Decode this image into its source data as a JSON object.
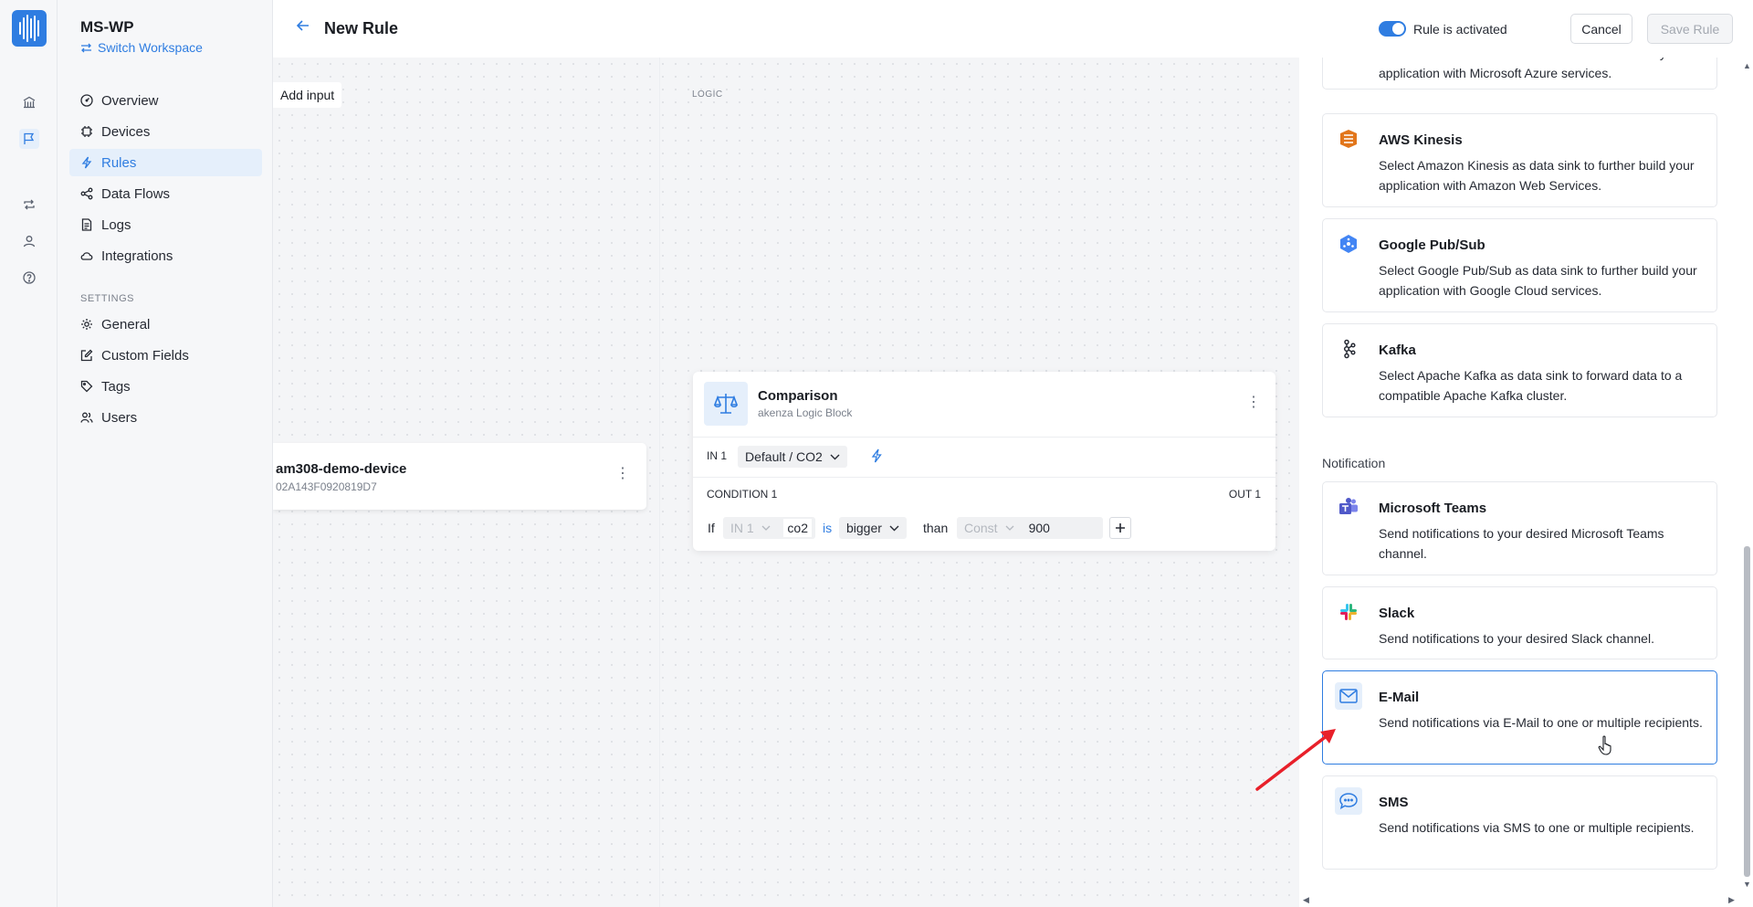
{
  "workspace": {
    "name": "MS-WP",
    "switch_label": "Switch Workspace"
  },
  "nav": {
    "items": [
      {
        "label": "Overview",
        "icon": "gauge-icon"
      },
      {
        "label": "Devices",
        "icon": "chip-icon"
      },
      {
        "label": "Rules",
        "icon": "lightning-icon",
        "active": true
      },
      {
        "label": "Data Flows",
        "icon": "share-icon"
      },
      {
        "label": "Logs",
        "icon": "document-icon"
      },
      {
        "label": "Integrations",
        "icon": "cloud-icon"
      }
    ],
    "settings_header": "SETTINGS",
    "settings_items": [
      {
        "label": "General",
        "icon": "gear-icon"
      },
      {
        "label": "Custom Fields",
        "icon": "edit-icon"
      },
      {
        "label": "Tags",
        "icon": "tag-icon"
      },
      {
        "label": "Users",
        "icon": "users-icon"
      }
    ]
  },
  "header": {
    "title": "New Rule",
    "toggle_label": "Rule is activated",
    "cancel_label": "Cancel",
    "save_label": "Save Rule"
  },
  "canvas": {
    "add_input_label": "Add input",
    "logic_label": "LOGIC",
    "device": {
      "name": "am308-demo-device",
      "id": "02A143F0920819D7"
    },
    "comparison": {
      "title": "Comparison",
      "subtitle": "akenza Logic Block",
      "in_label": "IN 1",
      "in_select": "Default / CO2",
      "condition_label": "CONDITION 1",
      "out_label": "OUT 1",
      "if_label": "If",
      "operand_in": "IN 1",
      "operand_field": "co2",
      "is_label": "is",
      "operator": "bigger",
      "than_label": "than",
      "const_label": "Const",
      "const_value": "900"
    }
  },
  "panel": {
    "partial_desc": "Select Azure IoT Hub as data sink to further build your application with Microsoft Azure services.",
    "data_sinks": [
      {
        "title": "AWS Kinesis",
        "desc": "Select Amazon Kinesis as data sink to further build your application with Amazon Web Services.",
        "icon": "aws-kinesis-icon",
        "color": "#e2761b"
      },
      {
        "title": "Google Pub/Sub",
        "desc": "Select Google Pub/Sub as data sink to further build your application with Google Cloud services.",
        "icon": "google-pubsub-icon",
        "color": "#4285f4"
      },
      {
        "title": "Kafka",
        "desc": "Select Apache Kafka as data sink to forward data to a compatible Apache Kafka cluster.",
        "icon": "kafka-icon",
        "color": "#262a33"
      }
    ],
    "notification_header": "Notification",
    "notifications": [
      {
        "title": "Microsoft Teams",
        "desc": "Send notifications to your desired Microsoft Teams channel.",
        "icon": "teams-icon",
        "color": "#5059c9"
      },
      {
        "title": "Slack",
        "desc": "Send notifications to your desired Slack channel.",
        "icon": "slack-icon",
        "color": "#e01e5a"
      },
      {
        "title": "E-Mail",
        "desc": "Send notifications via E-Mail to one or multiple recipients.",
        "icon": "mail-icon",
        "color": "#2f7de1",
        "selected": true
      },
      {
        "title": "SMS",
        "desc": "Send notifications via SMS to one or multiple recipients.",
        "icon": "chat-icon",
        "color": "#2f7de1"
      }
    ]
  },
  "annotation": {
    "arrow_color": "#e8202a"
  }
}
